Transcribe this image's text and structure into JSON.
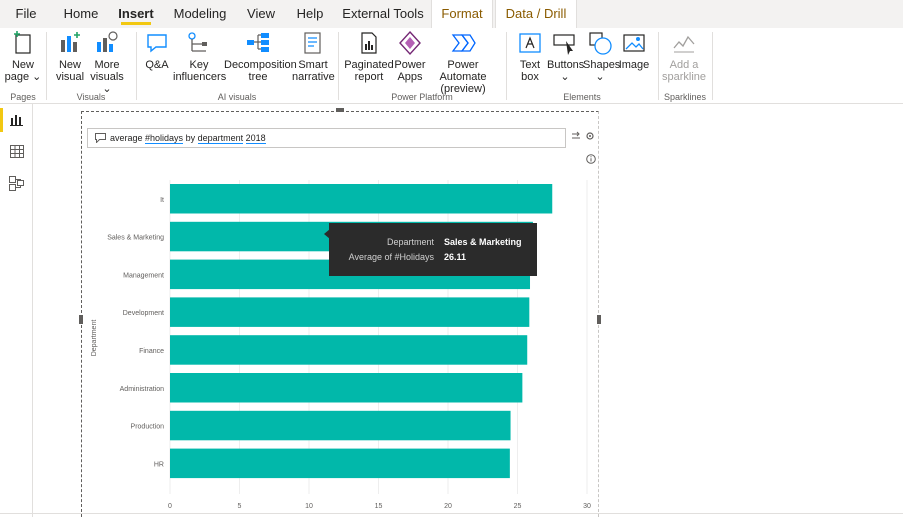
{
  "tabs": [
    "File",
    "Home",
    "Insert",
    "Modeling",
    "View",
    "Help",
    "External Tools",
    "Format",
    "Data / Drill"
  ],
  "ribbon": {
    "groups": {
      "pages": "Pages",
      "visuals": "Visuals",
      "ai_visuals": "AI visuals",
      "power_platform": "Power Platform",
      "elements": "Elements",
      "sparklines": "Sparklines"
    },
    "buttons": {
      "new_page": [
        "New",
        "page ⌄"
      ],
      "new_visual": [
        "New",
        "visual"
      ],
      "more_visuals": [
        "More",
        "visuals ⌄"
      ],
      "qa": [
        "Q&A"
      ],
      "key_influencers": [
        "Key",
        "influencers"
      ],
      "decomposition_tree": [
        "Decomposition",
        "tree"
      ],
      "smart_narrative": [
        "Smart",
        "narrative"
      ],
      "paginated_report": [
        "Paginated",
        "report"
      ],
      "power_apps": [
        "Power",
        "Apps"
      ],
      "power_automate": [
        "Power Automate",
        "(preview)"
      ],
      "text_box": [
        "Text",
        "box"
      ],
      "buttons": [
        "Buttons",
        "⌄"
      ],
      "shapes": [
        "Shapes",
        "⌄"
      ],
      "image": [
        "Image"
      ],
      "add_sparkline": [
        "Add a",
        "sparkline"
      ]
    }
  },
  "qna": {
    "query_parts": [
      "average ",
      "#holidays",
      " by ",
      "department",
      " ",
      "2018"
    ]
  },
  "chart_data": {
    "type": "bar",
    "orientation": "horizontal",
    "categories": [
      "It",
      "Sales & Marketing",
      "Management",
      "Development",
      "Finance",
      "Administration",
      "Production",
      "HR"
    ],
    "values": [
      27.5,
      26.11,
      25.9,
      25.85,
      25.7,
      25.35,
      24.5,
      24.45
    ],
    "ylabel": "Department",
    "xlim": [
      0,
      30
    ],
    "xticks": [
      0,
      5,
      10,
      15,
      20,
      25,
      30
    ],
    "bar_color": "#01b8aa",
    "grid": true
  },
  "tooltip": {
    "department_key": "Department",
    "department_value": "Sales & Marketing",
    "measure_key": "Average of #Holidays",
    "measure_value": "26.11"
  },
  "colors": {
    "accent": "#f2c811",
    "bar": "#01b8aa",
    "tooltip_bg": "#2b2b2b"
  }
}
